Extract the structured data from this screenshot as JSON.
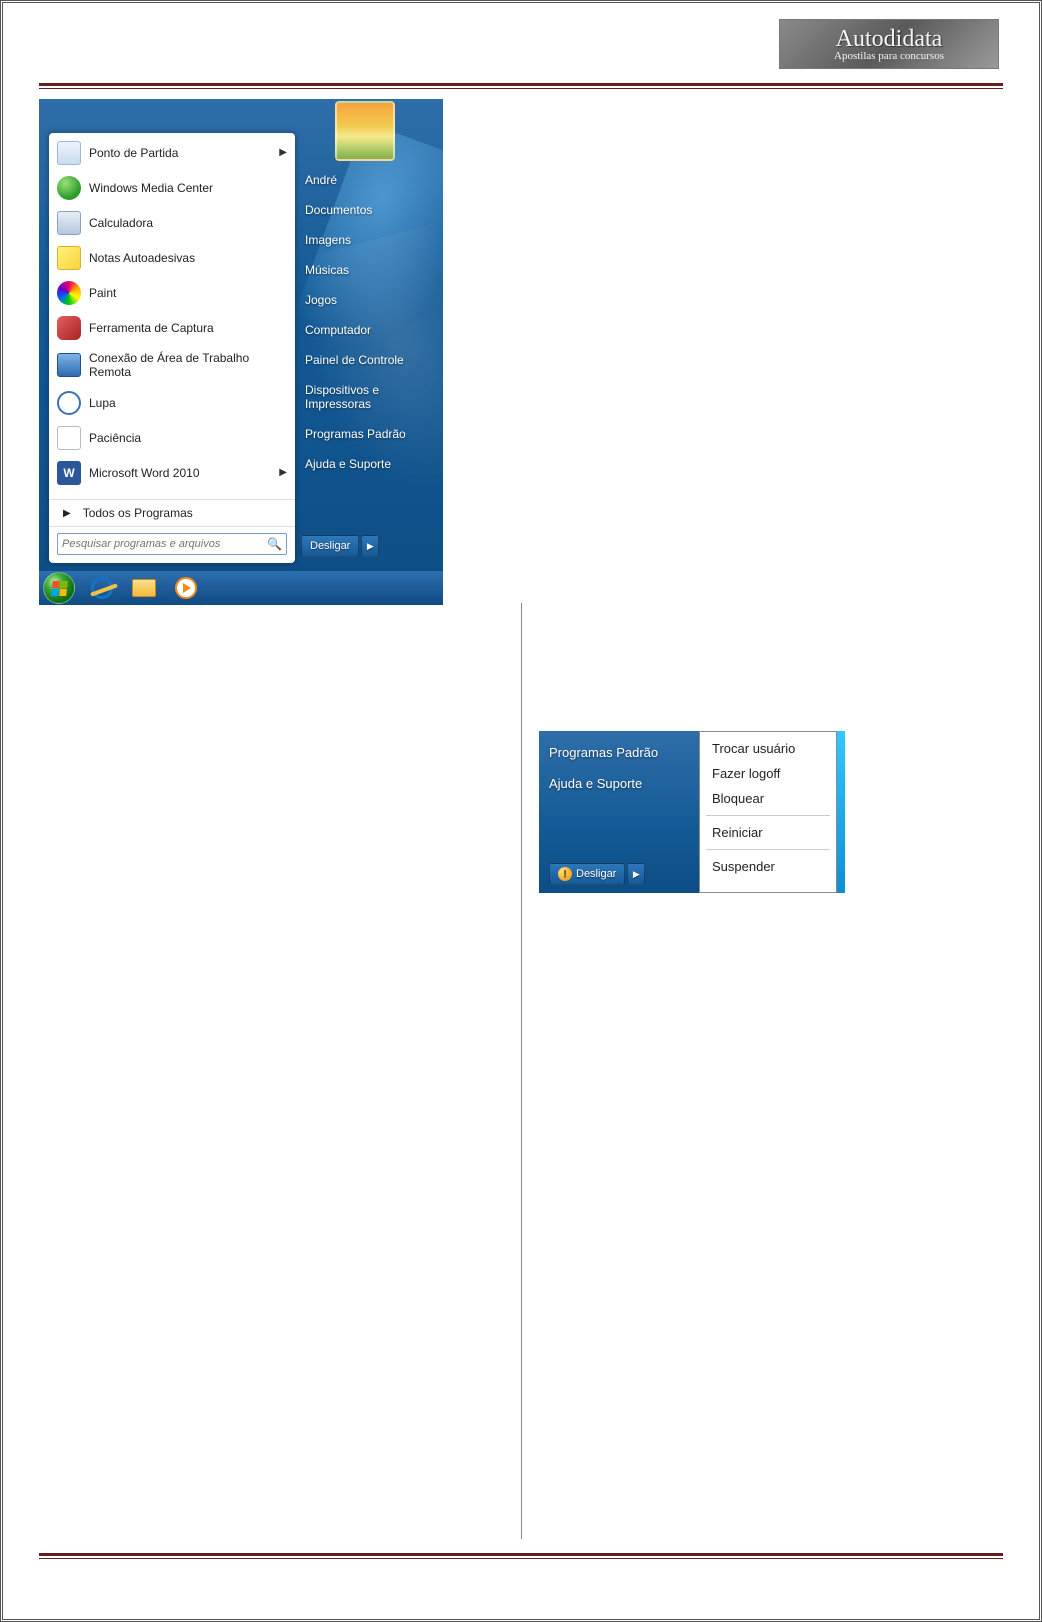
{
  "brand": {
    "main": "Autodidata",
    "sub": "Apostilas para concursos"
  },
  "startmenu": {
    "left_items": [
      {
        "label": "Ponto de Partida",
        "icon": "doc",
        "has_sub": true
      },
      {
        "label": "Windows Media Center",
        "icon": "wmc"
      },
      {
        "label": "Calculadora",
        "icon": "calc"
      },
      {
        "label": "Notas Autoadesivas",
        "icon": "note"
      },
      {
        "label": "Paint",
        "icon": "paint"
      },
      {
        "label": "Ferramenta de Captura",
        "icon": "snip"
      },
      {
        "label": "Conexão de Área de Trabalho Remota",
        "icon": "rdp"
      },
      {
        "label": "Lupa",
        "icon": "lupa"
      },
      {
        "label": "Paciência",
        "icon": "sol"
      },
      {
        "label": "Microsoft Word 2010",
        "icon": "word",
        "has_sub": true
      }
    ],
    "all_programs": "Todos os Programas",
    "search_placeholder": "Pesquisar programas e arquivos",
    "right_items": [
      "André",
      "Documentos",
      "Imagens",
      "Músicas",
      "Jogos",
      "Computador",
      "Painel de Controle",
      "Dispositivos e Impressoras",
      "Programas Padrão",
      "Ajuda e Suporte"
    ],
    "shutdown_label": "Desligar"
  },
  "shutdown_menu": {
    "left_visible": [
      "Programas Padrão",
      "Ajuda e Suporte"
    ],
    "shutdown_label": "Desligar",
    "options_group1": [
      "Trocar usuário",
      "Fazer logoff",
      "Bloquear"
    ],
    "options_group2": [
      "Reiniciar"
    ],
    "options_group3": [
      "Suspender"
    ]
  }
}
